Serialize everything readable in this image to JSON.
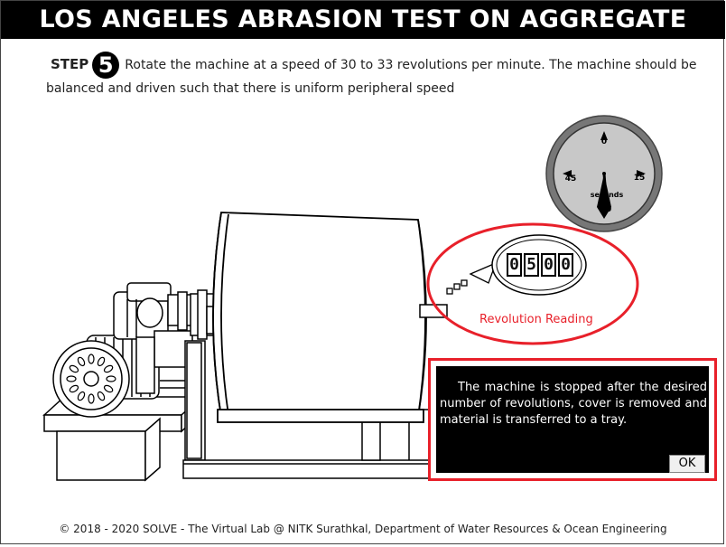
{
  "title": "LOS ANGELES ABRASION TEST ON AGGREGATE",
  "step": {
    "label": "STEP",
    "number": "5",
    "instruction": "Rotate the machine at a speed of 30 to 33 revolutions per minute. The machine should be balanced and driven such that there is uniform peripheral speed"
  },
  "clock": {
    "marks": [
      "0",
      "15",
      "30",
      "45"
    ],
    "unit": "seconds"
  },
  "revolution_counter": {
    "digits": [
      "0",
      "5",
      "0",
      "0"
    ],
    "label": "Revolution Reading"
  },
  "dialog": {
    "message": "The machine is stopped after the desired number of revolutions, cover is removed and material is transferred to a tray.",
    "ok_label": "OK"
  },
  "footer": "© 2018 - 2020 SOLVE - The Virtual Lab @ NITK Surathkal, Department of Water Resources & Ocean Engineering",
  "colors": {
    "highlight": "#e8202a",
    "dial_face": "#c8c8c8",
    "dial_rim": "#555555"
  }
}
